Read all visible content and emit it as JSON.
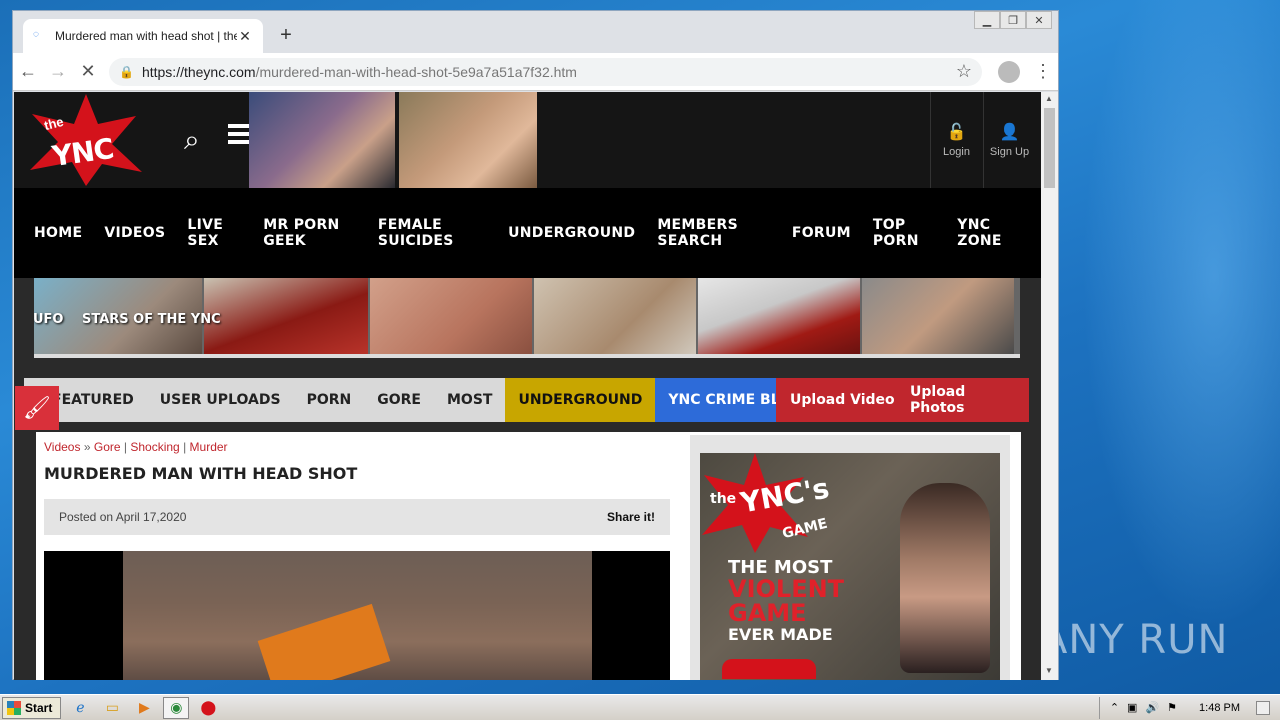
{
  "browser": {
    "tab_title": "Murdered man with head shot | theY",
    "url_host": "https://theync.com",
    "url_path": "/murdered-man-with-head-shot-5e9a7a51a7f32.htm"
  },
  "site": {
    "logo_the": "the",
    "logo_text": "YNC",
    "login_label": "Login",
    "signup_label": "Sign Up",
    "nav": [
      "HOME",
      "VIDEOS",
      "LIVE SEX",
      "MR PORN GEEK",
      "FEMALE SUICIDES",
      "UNDERGROUND",
      "MEMBERS SEARCH",
      "FORUM",
      "TOP PORN",
      "YNC ZONE"
    ],
    "strip_labels": [
      "UFO",
      "STARS OF THE YNC"
    ],
    "subnav": {
      "featured": "FEATURED",
      "user_uploads": "USER UPLOADS",
      "porn": "PORN",
      "gore": "GORE",
      "most": "MOST",
      "underground": "UNDERGROUND",
      "crime_blog": "YNC CRIME BLOG",
      "upload_video": "Upload Video",
      "upload_photos": "Upload Photos"
    },
    "breadcrumb": {
      "videos": "Videos",
      "gore": "Gore",
      "shocking": "Shocking",
      "murder": "Murder"
    },
    "page_title": "MURDERED MAN WITH HEAD SHOT",
    "posted_on": "Posted on April 17,2020",
    "share": "Share it!",
    "ad": {
      "line1": "the",
      "line2": "YNC's",
      "line3": "GAME",
      "line4": "THE MOST",
      "line5": "VIOLENT",
      "line6": "GAME",
      "line7": "EVER MADE"
    }
  },
  "watermark": "ANY RUN",
  "taskbar": {
    "start": "Start",
    "clock": "1:48 PM"
  },
  "colors": {
    "accent_red": "#c0262d",
    "underground": "#c8a600",
    "crime_blog": "#2d6bd9"
  }
}
